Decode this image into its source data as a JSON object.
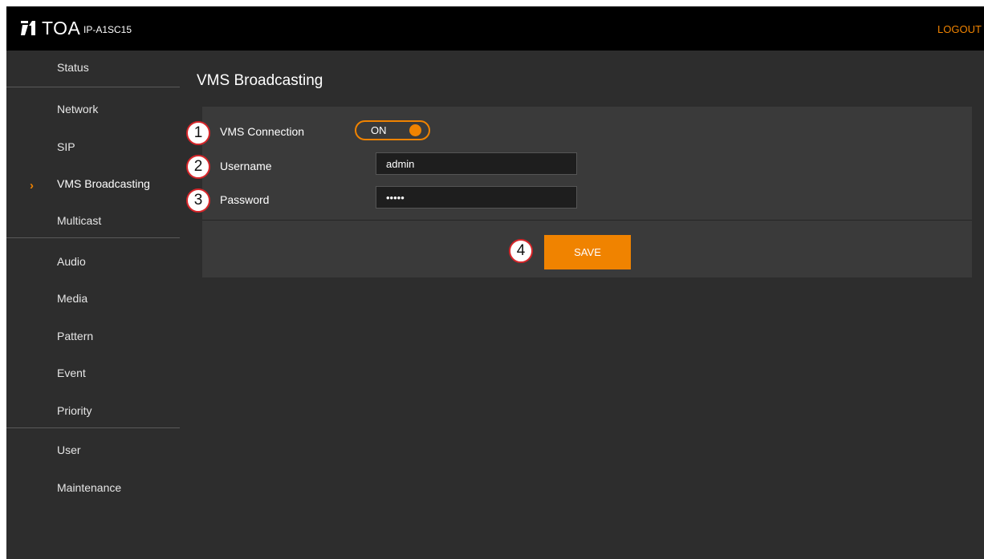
{
  "header": {
    "brand": "TOA",
    "model": "IP-A1SC15",
    "logout_label": "LOGOUT"
  },
  "sidebar": {
    "items": [
      {
        "label": "Status",
        "active": false
      },
      {
        "label": "Network",
        "active": false
      },
      {
        "label": "SIP",
        "active": false
      },
      {
        "label": "VMS Broadcasting",
        "active": true
      },
      {
        "label": "Multicast",
        "active": false
      },
      {
        "label": "Audio",
        "active": false
      },
      {
        "label": "Media",
        "active": false
      },
      {
        "label": "Pattern",
        "active": false
      },
      {
        "label": "Event",
        "active": false
      },
      {
        "label": "Priority",
        "active": false
      },
      {
        "label": "User",
        "active": false
      },
      {
        "label": "Maintenance",
        "active": false
      }
    ],
    "active_arrow": "›"
  },
  "main": {
    "title": "VMS Broadcasting",
    "vms_connection": {
      "label": "VMS Connection",
      "state": "ON",
      "marker": "1"
    },
    "username": {
      "label": "Username",
      "value": "admin",
      "marker": "2"
    },
    "password": {
      "label": "Password",
      "value": "•••••",
      "marker": "3"
    },
    "save": {
      "label": "SAVE",
      "marker": "4"
    }
  },
  "colors": {
    "accent": "#f08300",
    "background": "#2d2d2d",
    "panel": "#3a3a3a",
    "topbar": "#000000",
    "marker_border": "#d7262a"
  },
  "icons": {
    "logo": "toa-logo-icon",
    "active_nav": "chevron-right-icon"
  }
}
